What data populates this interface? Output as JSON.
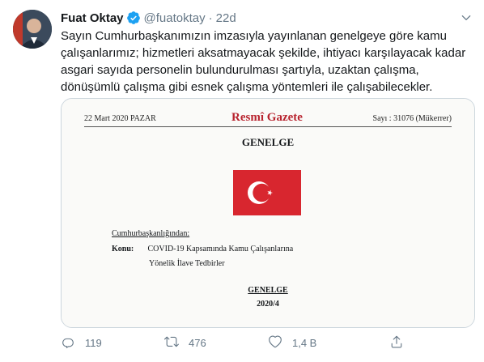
{
  "tweet": {
    "author_name": "Fuat Oktay",
    "handle": "@fuatoktay",
    "separator": "·",
    "time": "22d",
    "text": "Sayın Cumhurbaşkanımızın imzasıyla yayınlanan genelgeye göre kamu çalışanlarımız; hizmetleri aksatmayacak şekilde, ihtiyacı karşılayacak kadar asgari sayıda personelin bulundurulması şartıyla, uzaktan çalışma, dönüşümlü çalışma gibi esnek çalışma yöntemleri ile çalışabilecekler."
  },
  "document": {
    "date": "22 Mart 2020 PAZAR",
    "gazette_name": "Resmî Gazete",
    "issue": "Sayı : 31076 (Mükerrer)",
    "title": "GENELGE",
    "issuer": "Cumhurbaşkanlığından:",
    "subject_label": "Konu:",
    "subject_line1": "COVID-19 Kapsamında Kamu Çalışanlarına",
    "subject_line2": "Yönelik İlave Tedbirler",
    "footer_title": "GENELGE",
    "footer_number": "2020/4"
  },
  "actions": {
    "reply_count": "119",
    "retweet_count": "476",
    "like_count": "1,4 B"
  },
  "colors": {
    "accent": "#1da1f2",
    "gazette_red": "#b8242f",
    "flag_red": "#d8262f",
    "muted": "#657786"
  },
  "icons": [
    "verified-badge-icon",
    "chevron-down-icon",
    "reply-icon",
    "retweet-icon",
    "like-icon",
    "share-icon"
  ]
}
